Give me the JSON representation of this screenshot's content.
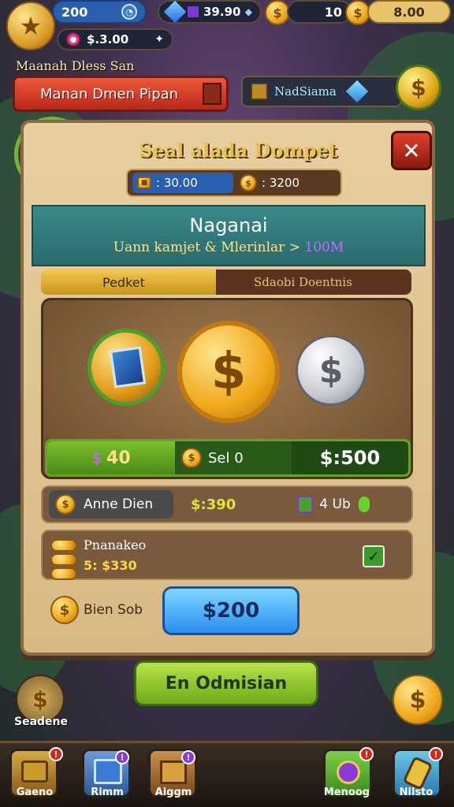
{
  "colors": {
    "accent_gold": "#f0a81c",
    "accent_green": "#6cab1a",
    "accent_blue": "#2a8ef0",
    "danger_red": "#d8261c"
  },
  "top_bar": {
    "stars_value": "200",
    "gems_value": "39.90",
    "coins_value": "10",
    "coins_value_2": "8.00",
    "energy_value": "$.3.00"
  },
  "quest": {
    "subtitle": "Maanah Dless San",
    "title_button": "Manan Dmen Pipan",
    "side_label": "NadSiama"
  },
  "panel": {
    "title": "Seal alada Dompet",
    "balance_1": ": 30.00",
    "balance_2": ": 3200",
    "banner_title": "Naganai",
    "banner_subtitle": "Uann kamjet & Mlerinlar",
    "banner_highlight": "100M",
    "tabs": [
      "Pedket",
      "Sdaobi Doentnis"
    ],
    "reward_value_1": "40",
    "reward_value_2": "Sel 0",
    "reward_price": "$:500",
    "row1_label": "Anne Dien",
    "row1_value": "$:390",
    "row1_count": "4 Ub",
    "row2_label": "Pnanakeo",
    "row2_value": "5: $330",
    "bottom_label": "Bien Sob",
    "bottom_price": "$200",
    "confirm_button": "En Odmisian"
  },
  "side": {
    "left_coin_label": "Seadene"
  },
  "nav": [
    {
      "label": "Gaeno"
    },
    {
      "label": "Rimm"
    },
    {
      "label": "Aiggm"
    },
    {
      "label": "Menoog"
    },
    {
      "label": "Nilsto"
    }
  ],
  "icons": [
    "star-icon",
    "clock-icon",
    "diamond-icon",
    "coin-icon",
    "close-icon",
    "checkmark-icon",
    "crystal-icon"
  ]
}
